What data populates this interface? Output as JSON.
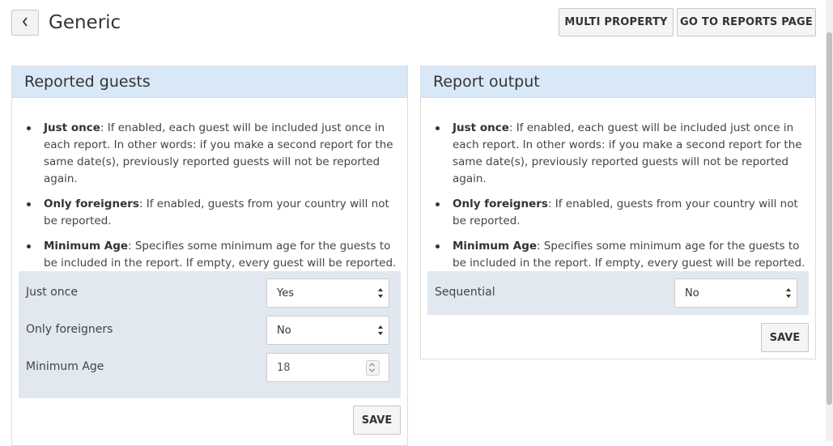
{
  "header": {
    "title": "Generic",
    "back_icon": "chevron-left-icon",
    "multi_property_label": "MULTI PROPERTY",
    "reports_page_label": "GO TO REPORTS PAGE"
  },
  "reported_guests": {
    "title": "Reported guests",
    "bullets": [
      {
        "term": "Just once",
        "text": ": If enabled, each guest will be included just once in each report. In other words: if you make a second report for the same date(s), previously reported guests will not be reported again."
      },
      {
        "term": "Only foreigners",
        "text": ": If enabled, guests from your country will not be reported."
      },
      {
        "term": "Minimum Age",
        "text": ": Specifies some minimum age for the guests to be included in the report. If empty, every guest will be reported."
      }
    ],
    "fields": {
      "just_once": {
        "label": "Just once",
        "value": "Yes"
      },
      "only_foreigners": {
        "label": "Only foreigners",
        "value": "No"
      },
      "minimum_age": {
        "label": "Minimum Age",
        "value": "18"
      }
    },
    "save_label": "SAVE"
  },
  "report_output": {
    "title": "Report output",
    "bullets": [
      {
        "term": "Just once",
        "text": ": If enabled, each guest will be included just once in each report. In other words: if you make a second report for the same date(s), previously reported guests will not be reported again."
      },
      {
        "term": "Only foreigners",
        "text": ": If enabled, guests from your country will not be reported."
      },
      {
        "term": "Minimum Age",
        "text": ": Specifies some minimum age for the guests to be included in the report. If empty, every guest will be reported."
      }
    ],
    "fields": {
      "sequential": {
        "label": "Sequential",
        "value": "No"
      }
    },
    "save_label": "SAVE"
  },
  "colors": {
    "panel_header": "#d9e8f7",
    "form_background": "#e2e8f0"
  }
}
